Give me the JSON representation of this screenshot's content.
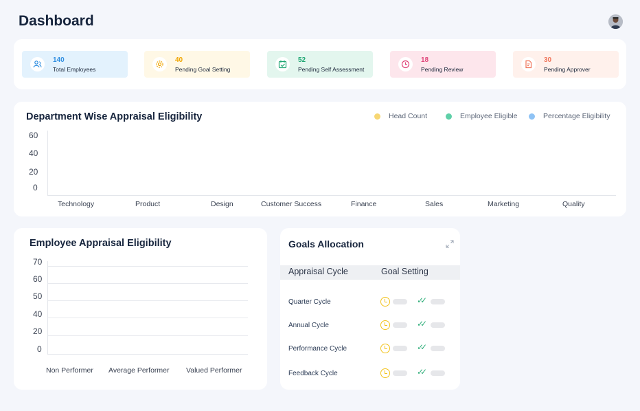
{
  "header": {
    "title": "Dashboard"
  },
  "stats": [
    {
      "value": "140",
      "label": "Total Employees",
      "icon": "users-icon",
      "bg": "#e3f2fd",
      "color": "#2f8ee0"
    },
    {
      "value": "40",
      "label": "Pending Goal Setting",
      "icon": "gear-icon",
      "bg": "#fff8e6",
      "color": "#f0a500"
    },
    {
      "value": "52",
      "label": "Pending  Self Assessment",
      "icon": "calendar-check-icon",
      "bg": "#e3f6ee",
      "color": "#1ea672"
    },
    {
      "value": "18",
      "label": "Pending Review",
      "icon": "clock-icon",
      "bg": "#fde6ec",
      "color": "#e0457a"
    },
    {
      "value": "30",
      "label": "Pending Approver",
      "icon": "document-icon",
      "bg": "#fff1ec",
      "color": "#f0745a"
    }
  ],
  "department_chart": {
    "title": "Department Wise Appraisal Eligibility",
    "legend": [
      {
        "label": "Head Count",
        "color": "#f7d774"
      },
      {
        "label": "Employee Eligible",
        "color": "#5fd0a8"
      },
      {
        "label": "Percentage Eligibility",
        "color": "#8fc3f5"
      }
    ]
  },
  "employee_chart": {
    "title": "Employee Appraisal Eligibility"
  },
  "goals": {
    "title": "Goals Allocation",
    "col_cycle": "Appraisal Cycle",
    "col_goal": "Goal Setting",
    "rows": [
      {
        "name": "Quarter Cycle"
      },
      {
        "name": "Annual Cycle"
      },
      {
        "name": "Performance Cycle"
      },
      {
        "name": "Feedback Cycle"
      }
    ],
    "status_icons": [
      "clock-icon",
      "double-check-icon"
    ]
  },
  "chart_data": [
    {
      "type": "bar",
      "title": "Department Wise Appraisal Eligibility",
      "categories": [
        "Technology",
        "Product",
        "Design",
        "Customer Success",
        "Finance",
        "Sales",
        "Marketing",
        "Quality"
      ],
      "series": [
        {
          "name": "Head Count",
          "values": []
        },
        {
          "name": "Employee Eligible",
          "values": []
        },
        {
          "name": "Percentage Eligibility",
          "values": []
        }
      ],
      "ylim": [
        0,
        60
      ],
      "yticks": [
        "60",
        "40",
        "20",
        "0"
      ],
      "legend_position": "top-right",
      "grid": false
    },
    {
      "type": "bar",
      "title": "Employee Appraisal Eligibility",
      "categories": [
        "Non Performer",
        "Average Performer",
        "Valued Performer"
      ],
      "values": [],
      "ylim": [
        0,
        70
      ],
      "yticks": [
        "70",
        "60",
        "50",
        "40",
        "20",
        "0"
      ],
      "grid": true
    }
  ]
}
